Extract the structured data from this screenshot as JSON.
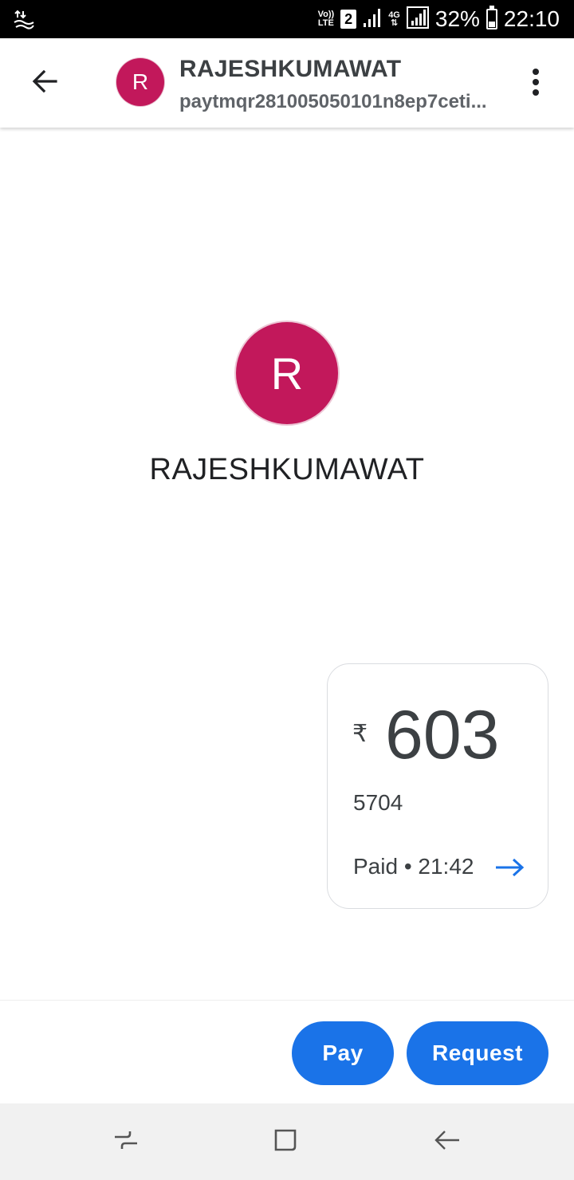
{
  "status_bar": {
    "volte_line1": "Vo))",
    "volte_line2": "LTE",
    "sim_slot": "2",
    "network_type": "4G",
    "battery_percent": "32%",
    "battery_level": 0.32,
    "time": "22:10"
  },
  "header": {
    "avatar_letter": "R",
    "title": "RAJESHKUMAWAT",
    "subtitle": "paytmqr281005050101n8ep7ceti..."
  },
  "contact": {
    "avatar_letter": "R",
    "name": "RAJESHKUMAWAT",
    "avatar_color": "#c2185b"
  },
  "transaction": {
    "currency_symbol": "₹",
    "amount": "603",
    "note": "5704",
    "status": "Paid • 21:42"
  },
  "actions": {
    "pay_label": "Pay",
    "request_label": "Request",
    "accent_color": "#1a73e8"
  },
  "icons": {
    "back": "arrow-back-icon",
    "more": "more-vert-icon",
    "details": "arrow-forward-icon",
    "nav_recent": "recent-apps-icon",
    "nav_home": "home-icon",
    "nav_back": "nav-back-icon"
  }
}
